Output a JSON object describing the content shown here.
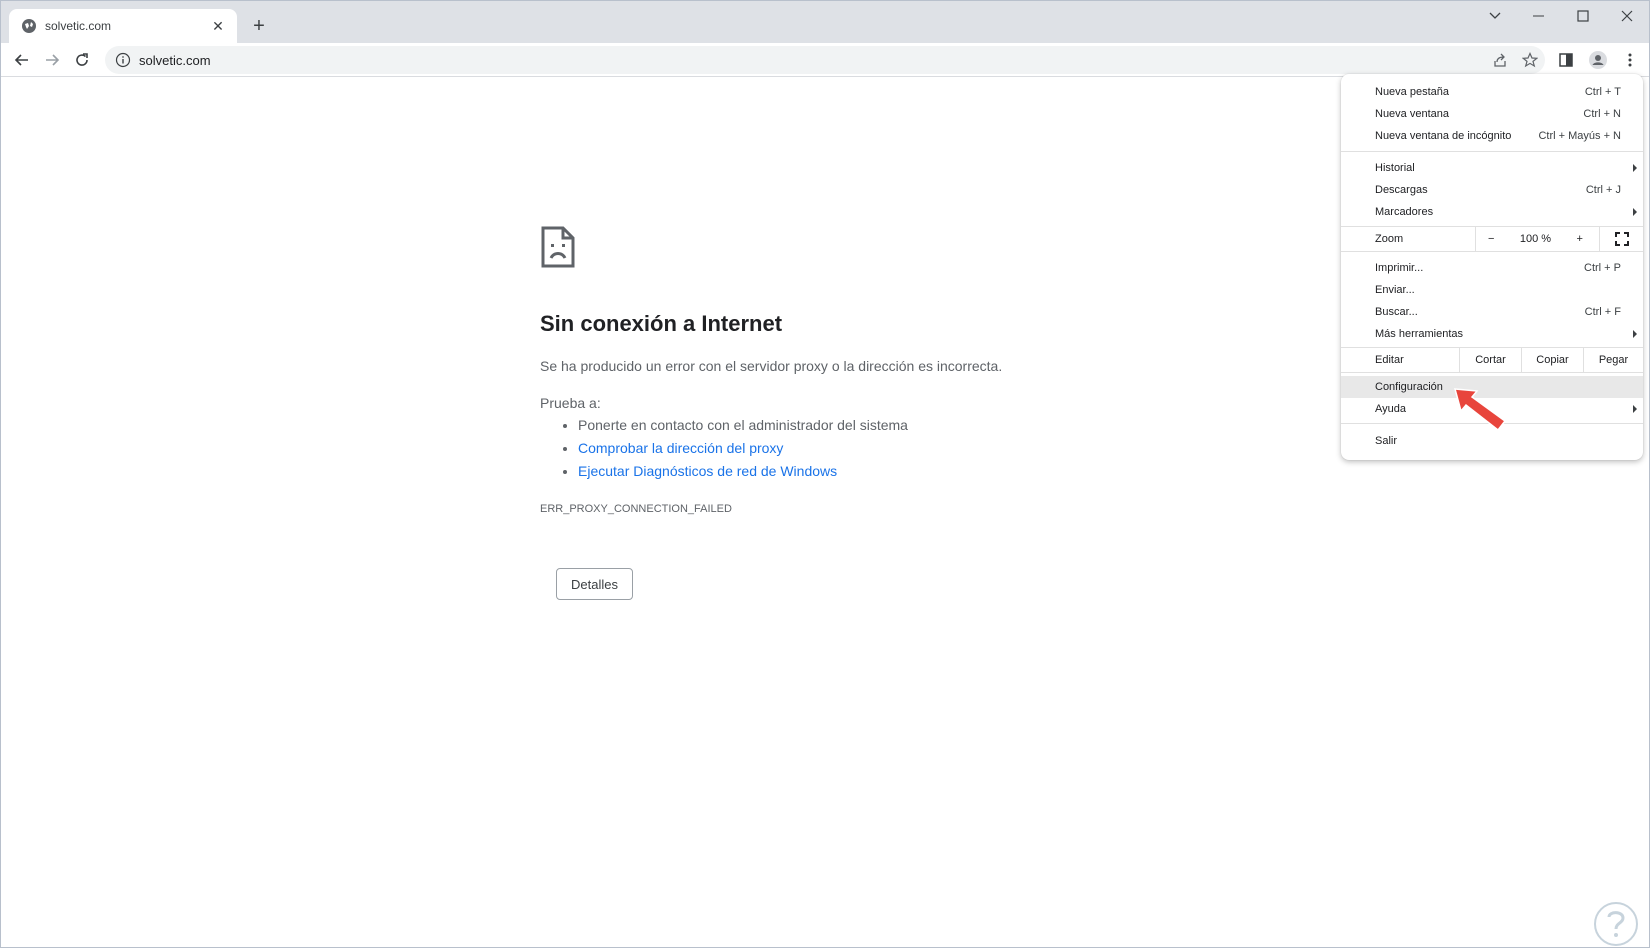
{
  "tab": {
    "title": "solvetic.com",
    "close": "✕"
  },
  "newtab": "+",
  "window_controls": {
    "dropdown": "⌄",
    "minimize": "—",
    "maximize": "☐",
    "close": "✕"
  },
  "address": {
    "url": "solvetic.com"
  },
  "error": {
    "title": "Sin conexión a Internet",
    "description": "Se ha producido un error con el servidor proxy o la dirección es incorrecta.",
    "try_label": "Prueba a:",
    "suggestions": [
      {
        "text": "Ponerte en contacto con el administrador del sistema",
        "link": false
      },
      {
        "text": "Comprobar la dirección del proxy",
        "link": true
      },
      {
        "text": "Ejecutar Diagnósticos de red de Windows",
        "link": true
      }
    ],
    "code": "ERR_PROXY_CONNECTION_FAILED",
    "details_button": "Detalles"
  },
  "menu": {
    "new_tab": {
      "label": "Nueva pestaña",
      "shortcut": "Ctrl + T"
    },
    "new_window": {
      "label": "Nueva ventana",
      "shortcut": "Ctrl + N"
    },
    "incognito": {
      "label": "Nueva ventana de incógnito",
      "shortcut": "Ctrl + Mayús + N"
    },
    "history": {
      "label": "Historial"
    },
    "downloads": {
      "label": "Descargas",
      "shortcut": "Ctrl + J"
    },
    "bookmarks": {
      "label": "Marcadores"
    },
    "zoom": {
      "label": "Zoom",
      "minus": "−",
      "value": "100 %",
      "plus": "+"
    },
    "print": {
      "label": "Imprimir...",
      "shortcut": "Ctrl + P"
    },
    "cast": {
      "label": "Enviar..."
    },
    "find": {
      "label": "Buscar...",
      "shortcut": "Ctrl + F"
    },
    "more_tools": {
      "label": "Más herramientas"
    },
    "edit": {
      "label": "Editar",
      "cut": "Cortar",
      "copy": "Copiar",
      "paste": "Pegar"
    },
    "settings": {
      "label": "Configuración"
    },
    "help": {
      "label": "Ayuda"
    },
    "exit": {
      "label": "Salir"
    }
  },
  "colors": {
    "link": "#1a73e8",
    "pointer": "#e8453c",
    "tabstrip": "#dee1e6"
  }
}
